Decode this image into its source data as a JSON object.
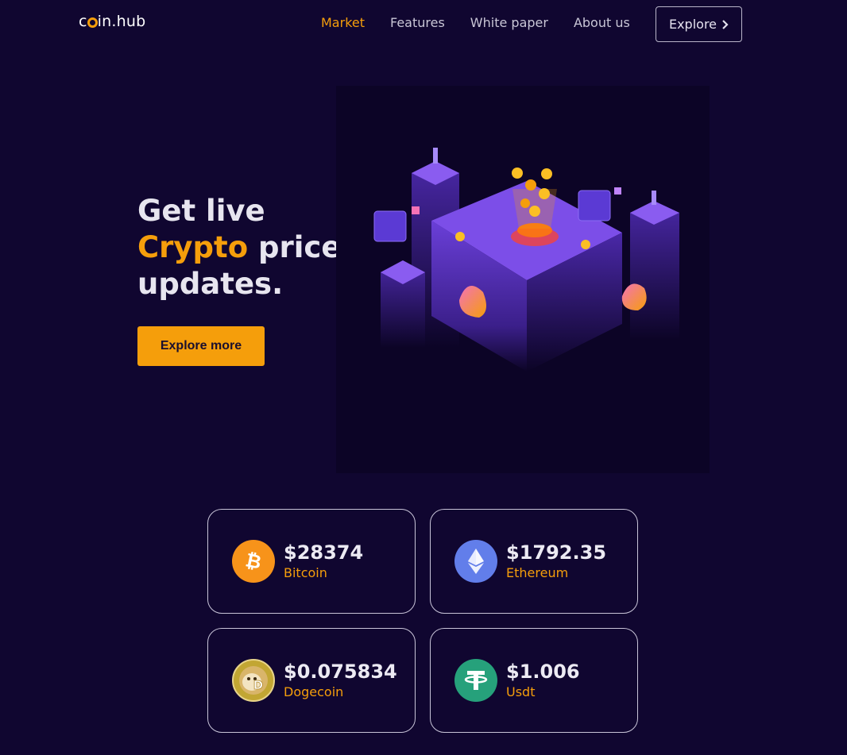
{
  "brand": {
    "logo_prefix": "c",
    "logo_suffix": "in.hub"
  },
  "nav": {
    "items": [
      {
        "label": "Market",
        "active": true
      },
      {
        "label": "Features",
        "active": false
      },
      {
        "label": "White paper",
        "active": false
      },
      {
        "label": "About us",
        "active": false
      }
    ],
    "explore_label": "Explore"
  },
  "hero": {
    "line1": "Get live",
    "accent_word": "Crypto",
    "line2_rest": " price",
    "line3": "updates.",
    "cta_label": "Explore more"
  },
  "coins": [
    {
      "price": "$28374",
      "name": "Bitcoin",
      "icon": "bitcoin-icon",
      "color": "#f7931a"
    },
    {
      "price": "$1792.35",
      "name": "Ethereum",
      "icon": "ethereum-icon",
      "color": "#627eea"
    },
    {
      "price": "$0.075834",
      "name": "Dogecoin",
      "icon": "dogecoin-icon",
      "color": "#c2a633"
    },
    {
      "price": "$1.006",
      "name": "Usdt",
      "icon": "usdt-icon",
      "color": "#26a17b"
    }
  ],
  "colors": {
    "background": "#100630",
    "accent": "#f59e0b"
  }
}
